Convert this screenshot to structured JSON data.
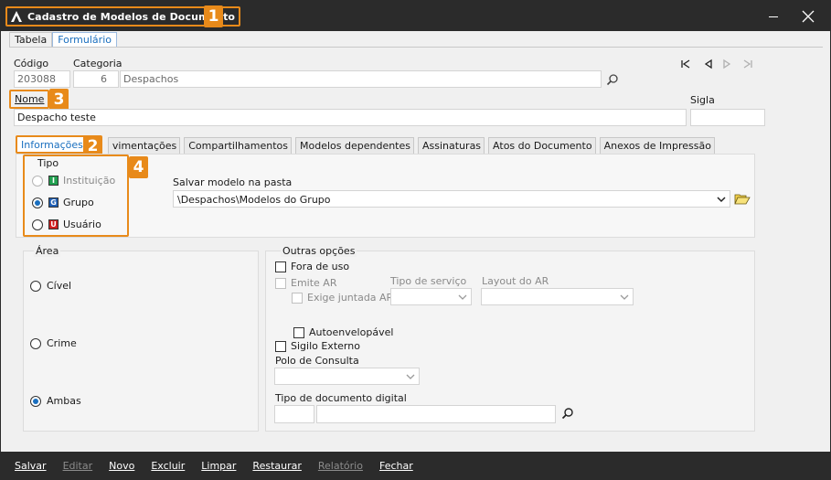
{
  "window": {
    "title": "Cadastro de Modelos de Documento",
    "accent": "#e88a1a",
    "titlebar_color": "#2b2b2b"
  },
  "badges": {
    "b1": "1",
    "b2": "2",
    "b3": "3",
    "b4": "4"
  },
  "tabs_top": [
    {
      "label": "Tabela"
    },
    {
      "label": "Formulário"
    }
  ],
  "header": {
    "codigo_label": "Código",
    "codigo_value": "203088",
    "categoria_label": "Categoria",
    "categoria_num": "6",
    "categoria_name": "Despachos",
    "nome_label": "Nome",
    "nome_value": "Despacho teste",
    "sigla_label": "Sigla",
    "sigla_value": ""
  },
  "inner_tabs": [
    {
      "label": "Informações"
    },
    {
      "label": "vimentações"
    },
    {
      "label": "Compartilhamentos"
    },
    {
      "label": "Modelos dependentes"
    },
    {
      "label": "Assinaturas"
    },
    {
      "label": "Atos do Documento"
    },
    {
      "label": "Anexos de Impressão"
    }
  ],
  "tipo": {
    "label": "Tipo",
    "options": [
      {
        "label": "Instituição",
        "letter": "I",
        "color": "#22a050",
        "selected": false,
        "disabled": true
      },
      {
        "label": "Grupo",
        "letter": "G",
        "color": "#1f5fb4",
        "selected": true,
        "disabled": false
      },
      {
        "label": "Usuário",
        "letter": "U",
        "color": "#d02020",
        "selected": false,
        "disabled": false
      }
    ]
  },
  "pasta": {
    "label": "Salvar modelo na pasta",
    "value": "\\Despachos\\Modelos do Grupo"
  },
  "area": {
    "label": "Área",
    "options": [
      {
        "label": "Cível",
        "selected": false
      },
      {
        "label": "Crime",
        "selected": false
      },
      {
        "label": "Ambas",
        "selected": true
      }
    ]
  },
  "outras": {
    "label": "Outras opções",
    "fora_de_uso": "Fora de uso",
    "emite_ar": "Emite AR",
    "exige_juntada_ar": "Exige juntada AR",
    "tipo_servico": "Tipo de serviço",
    "layout_ar": "Layout do AR",
    "autoenvelopavel": "Autoenvelopável",
    "sigilo_externo": "Sigilo Externo",
    "polo_consulta": "Polo de Consulta",
    "tipo_doc_digital": "Tipo de documento digital"
  },
  "bottom": [
    {
      "label": "Salvar",
      "disabled": false
    },
    {
      "label": "Editar",
      "disabled": true
    },
    {
      "label": "Novo",
      "disabled": false
    },
    {
      "label": "Excluir",
      "disabled": false
    },
    {
      "label": "Limpar",
      "disabled": false
    },
    {
      "label": "Restaurar",
      "disabled": false
    },
    {
      "label": "Relatório",
      "disabled": true
    },
    {
      "label": "Fechar",
      "disabled": false
    }
  ]
}
